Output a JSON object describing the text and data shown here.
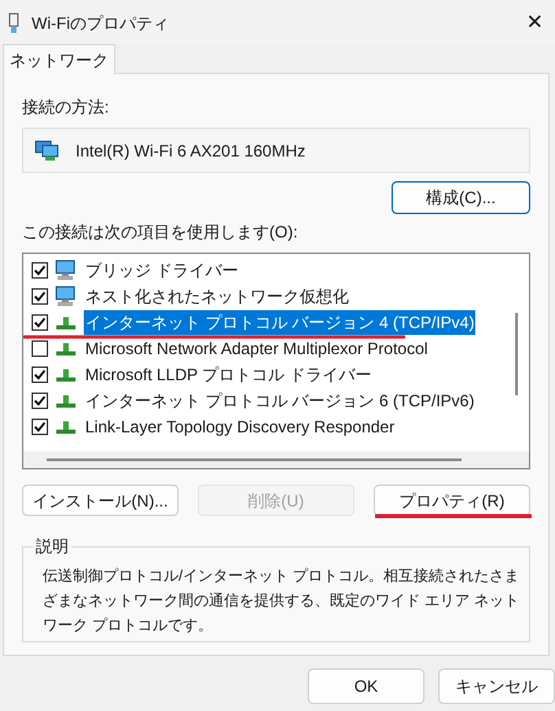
{
  "window": {
    "title": "Wi-Fiのプロパティ",
    "close": "✕"
  },
  "tabs": [
    {
      "label": "ネットワーク",
      "selected": true
    }
  ],
  "connect_using": {
    "label": "接続の方法:",
    "adapter": "Intel(R) Wi-Fi 6 AX201 160MHz",
    "configure_button": "構成(C)..."
  },
  "items_label": "この接続は次の項目を使用します(O):",
  "items": [
    {
      "name": "ブリッジ ドライバー",
      "kind": "client",
      "checked": true,
      "selected": false
    },
    {
      "name": "ネスト化されたネットワーク仮想化",
      "kind": "client",
      "checked": true,
      "selected": false
    },
    {
      "name": "インターネット プロトコル バージョン 4 (TCP/IPv4)",
      "kind": "protocol",
      "checked": true,
      "selected": true
    },
    {
      "name": "Microsoft Network Adapter Multiplexor Protocol",
      "kind": "protocol",
      "checked": false,
      "selected": false
    },
    {
      "name": "Microsoft LLDP プロトコル ドライバー",
      "kind": "protocol",
      "checked": true,
      "selected": false
    },
    {
      "name": "インターネット プロトコル バージョン 6 (TCP/IPv6)",
      "kind": "protocol",
      "checked": true,
      "selected": false
    },
    {
      "name": "Link-Layer Topology Discovery Responder",
      "kind": "protocol",
      "checked": true,
      "selected": false
    }
  ],
  "actions": [
    {
      "label": "インストール(N)...",
      "disabled": false
    },
    {
      "label": "削除(U)",
      "disabled": true
    },
    {
      "label": "プロパティ(R)",
      "disabled": false
    }
  ],
  "description": {
    "legend": "説明",
    "text": "伝送制御プロトコル/インターネット プロトコル。相互接続されたさまざまなネットワーク間の通信を提供する、既定のワイド エリア ネットワーク プロトコルです。"
  },
  "footer_buttons": [
    "OK",
    "キャンセル"
  ]
}
